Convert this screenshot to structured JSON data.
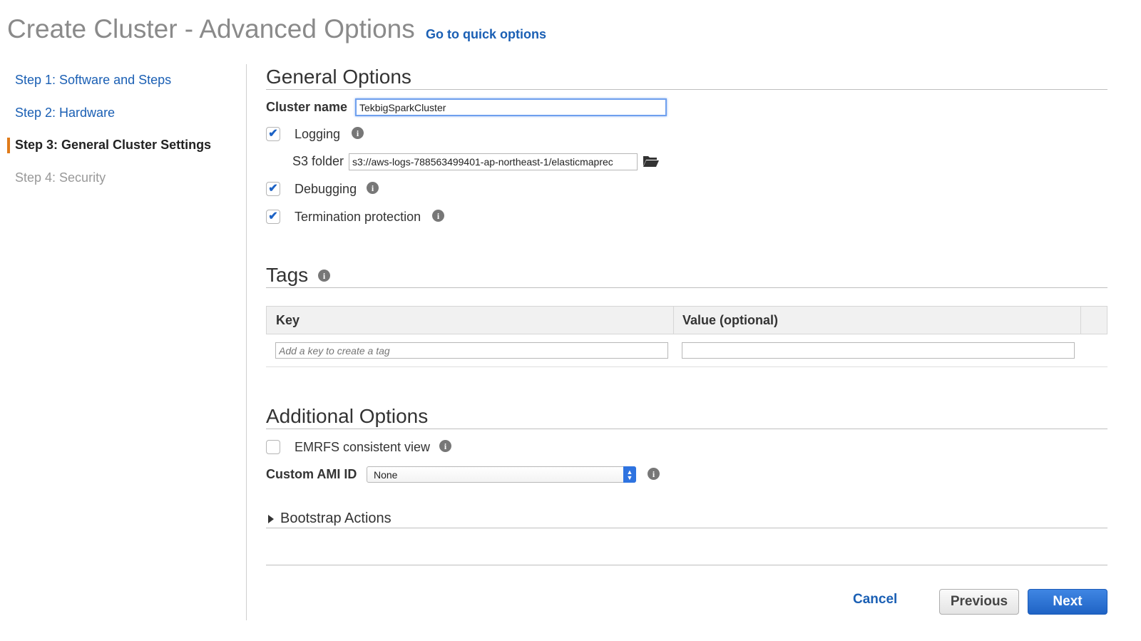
{
  "page": {
    "title": "Create Cluster - Advanced Options",
    "quick_options_link": "Go to quick options"
  },
  "steps": [
    {
      "label": "Step 1: Software and Steps",
      "state": "link"
    },
    {
      "label": "Step 2: Hardware",
      "state": "link"
    },
    {
      "label": "Step 3: General Cluster Settings",
      "state": "active"
    },
    {
      "label": "Step 4: Security",
      "state": "disabled"
    }
  ],
  "general_options": {
    "title": "General Options",
    "cluster_name_label": "Cluster name",
    "cluster_name_value": "TekbigSparkCluster",
    "logging_label": "Logging",
    "logging_checked": true,
    "s3_folder_label": "S3 folder",
    "s3_folder_value": "s3://aws-logs-788563499401-ap-northeast-1/elasticmaprec",
    "debugging_label": "Debugging",
    "debugging_checked": true,
    "termination_label": "Termination protection",
    "termination_checked": true
  },
  "tags": {
    "title": "Tags",
    "key_header": "Key",
    "value_header": "Value (optional)",
    "key_placeholder": "Add a key to create a tag",
    "value_placeholder": ""
  },
  "additional_options": {
    "title": "Additional Options",
    "emrfs_label": "EMRFS consistent view",
    "emrfs_checked": false,
    "ami_label": "Custom AMI ID",
    "ami_value": "None",
    "bootstrap_label": "Bootstrap Actions"
  },
  "footer": {
    "cancel": "Cancel",
    "previous": "Previous",
    "next": "Next"
  },
  "colors": {
    "link": "#1a5fb4",
    "active_marker": "#e07b1a",
    "primary_button": "#1f63c5",
    "checkbox_tick": "#1c62c5"
  }
}
